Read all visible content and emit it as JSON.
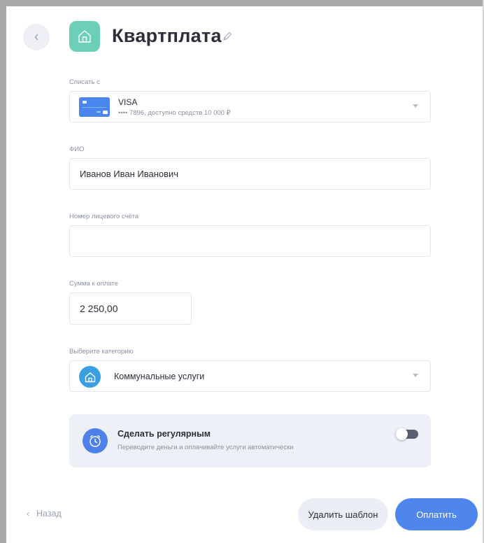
{
  "header": {
    "title": "Квартплата",
    "back_icon": "chevron-left-icon",
    "title_icon": "home-icon",
    "edit_icon": "pencil-icon"
  },
  "form": {
    "source": {
      "label": "Списать с",
      "card_name": "VISA",
      "card_details": "•••• 7896, доступно средств 10 000 ₽"
    },
    "fio": {
      "label": "ФИО",
      "value": "Иванов Иван Иванович"
    },
    "account": {
      "label": "Номер лицевого счёта",
      "value": ""
    },
    "amount": {
      "label": "Сумма к оплате",
      "value": "2 250,00"
    },
    "category": {
      "label": "Выберите категорию",
      "value": "Коммунальные услуги"
    },
    "regular": {
      "title": "Сделать регулярным",
      "subtitle": "Переводите деньги и оплачивайте услуги автоматически",
      "enabled": false
    }
  },
  "footer": {
    "back_label": "Назад",
    "delete_label": "Удалить шаблон",
    "pay_label": "Оплатить"
  },
  "colors": {
    "accent": "#4f86ee",
    "title_icon_bg": "#6ccfb8",
    "category_icon_bg": "#3a9fe0"
  }
}
